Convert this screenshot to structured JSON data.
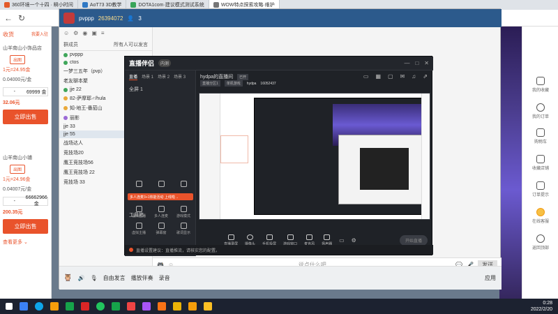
{
  "browser": {
    "tabs": [
      "360环境一个十四 · 瞬小时间",
      "AoT73 3D教学",
      "DOTA1com·建议模式测试系统",
      "WOW特点探索攻略·维护"
    ],
    "address": ""
  },
  "shop": {
    "header_left": "收货",
    "header_right": "我要入驻",
    "store1": "山羊南山小饰品店",
    "store1_pill": "出图",
    "price1": "1元=24.95金",
    "rate1": "0.04000元/金",
    "amount1": "69999 金",
    "total1": "32.06元",
    "buy_label": "立即出售",
    "store2": "山羊南山小铺",
    "store2_pill": "出图",
    "price2": "1元=24.96金",
    "rate2": "0.04007元/金",
    "amount2": "66662966 金",
    "total2": "200.35元",
    "more": "查看更多 ⌄"
  },
  "right_sidebar": [
    "我的收藏",
    "我的订单",
    "购物车",
    "收藏店铺",
    "订单提示",
    "在线客服",
    "返回顶部"
  ],
  "chat": {
    "user": "pvppp",
    "uid": "26394072",
    "count": "3",
    "left_title": "群成员",
    "left_right": "所有人可以发言",
    "list": [
      "pvppp",
      "ctos",
      "一梦三五年（pvp）",
      "老友聊本聚",
      "jje 22",
      "82-萨摩耶♂/hula",
      "知-地王-番茄山",
      "丽影",
      "jje 33",
      "jje 55",
      "战场达人",
      "竞技场20",
      "鹰王竞技场56",
      "鹰王竞技场 22",
      "竞技场 33"
    ],
    "input_placeholder": "说点什么吧...",
    "bottom": [
      "自由发言",
      "播放伴奏",
      "录音"
    ],
    "send_label": "发送",
    "app_label": "应用"
  },
  "stream": {
    "app_name": "直播伴侣",
    "version": "内测",
    "tabs": [
      "直播",
      "场景 1",
      "场景 2",
      "场景 3"
    ],
    "scene": "全屏 1",
    "tools_title": "工具箱",
    "tools": [
      "",
      "",
      "",
      "视频直播",
      "多人连麦",
      "游戏模式",
      "虚拟主播",
      "弹幕窗",
      "歌词显示",
      "",
      "",
      ""
    ],
    "promo": "多人连麦3+1热能活动 上线啦→",
    "room": "hydpa的直播间",
    "room_tag": "已开",
    "room_subtags": [
      "直播分区1",
      "单机游戏"
    ],
    "room_id": "hydpa",
    "room_num": "16052437",
    "controls": [
      "直播录屏",
      "摄像头",
      "手机投屏",
      "游戏窗口",
      "麦克风",
      "扬声器"
    ],
    "start_label": "开始直播",
    "status": "直播设置建议：直播推流，请核实您的配置。"
  },
  "clock": {
    "time": "0:28",
    "date": "2022/2/20"
  },
  "colors": {
    "accent": "#e9532b",
    "chat_header": "#2c5a8c",
    "stream_bg": "#1f2227",
    "taskbar": "#1c2230"
  }
}
